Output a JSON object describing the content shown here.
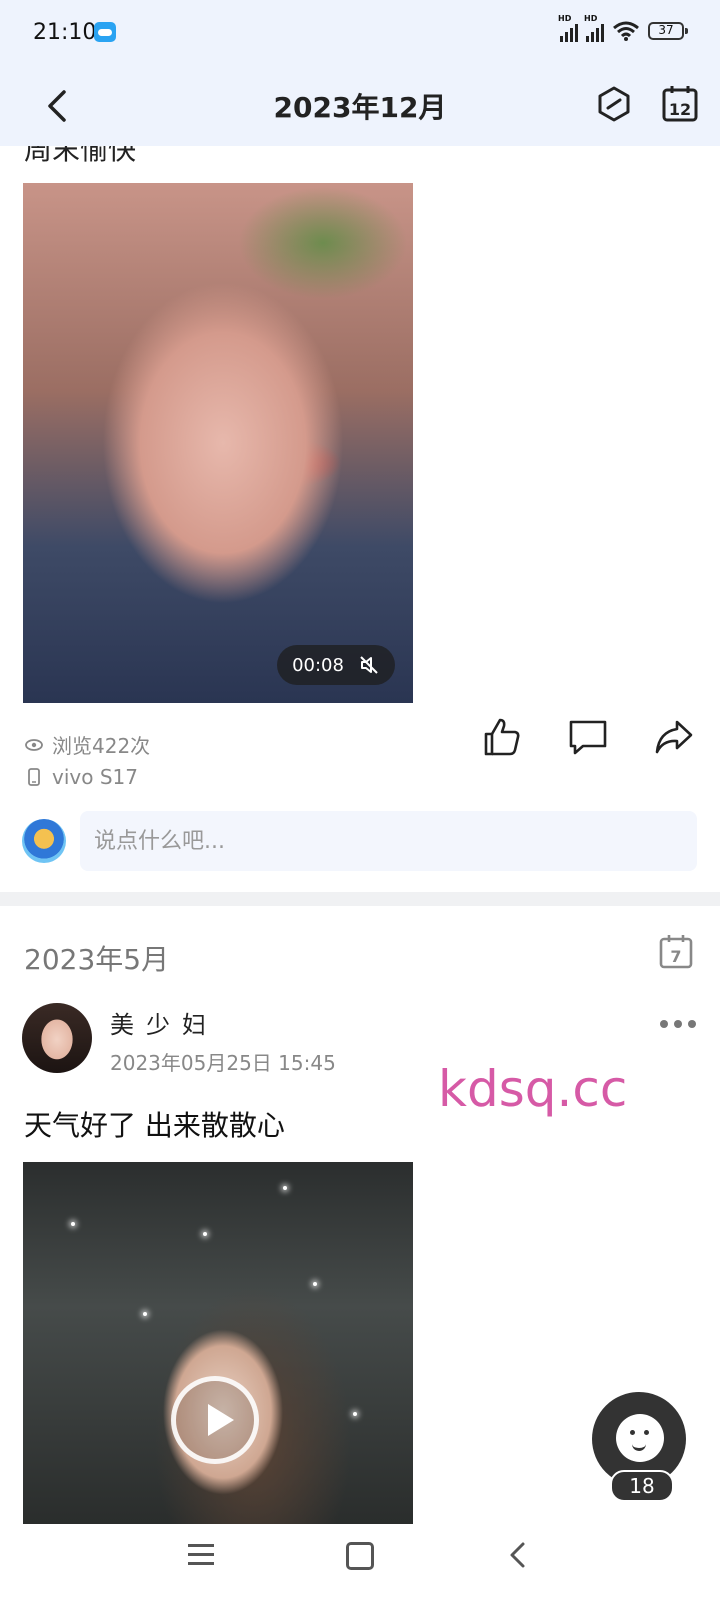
{
  "status_bar": {
    "time": "21:10",
    "battery": "37"
  },
  "header": {
    "title": "2023年12月"
  },
  "post1": {
    "cut_text": "周末愉快",
    "video_duration": "00:08",
    "views": "浏览422次",
    "device": "vivo S17"
  },
  "comment": {
    "placeholder": "说点什么吧..."
  },
  "section": {
    "title": "2023年5月",
    "calendar_day": "7"
  },
  "post2": {
    "user_name": "美少妇",
    "time": "2023年05月25日 15:45",
    "text": "天气好了 出来散散心"
  },
  "watermark": "kdsq.cc",
  "floating": {
    "badge": "18"
  },
  "top_calendar_day": "12"
}
